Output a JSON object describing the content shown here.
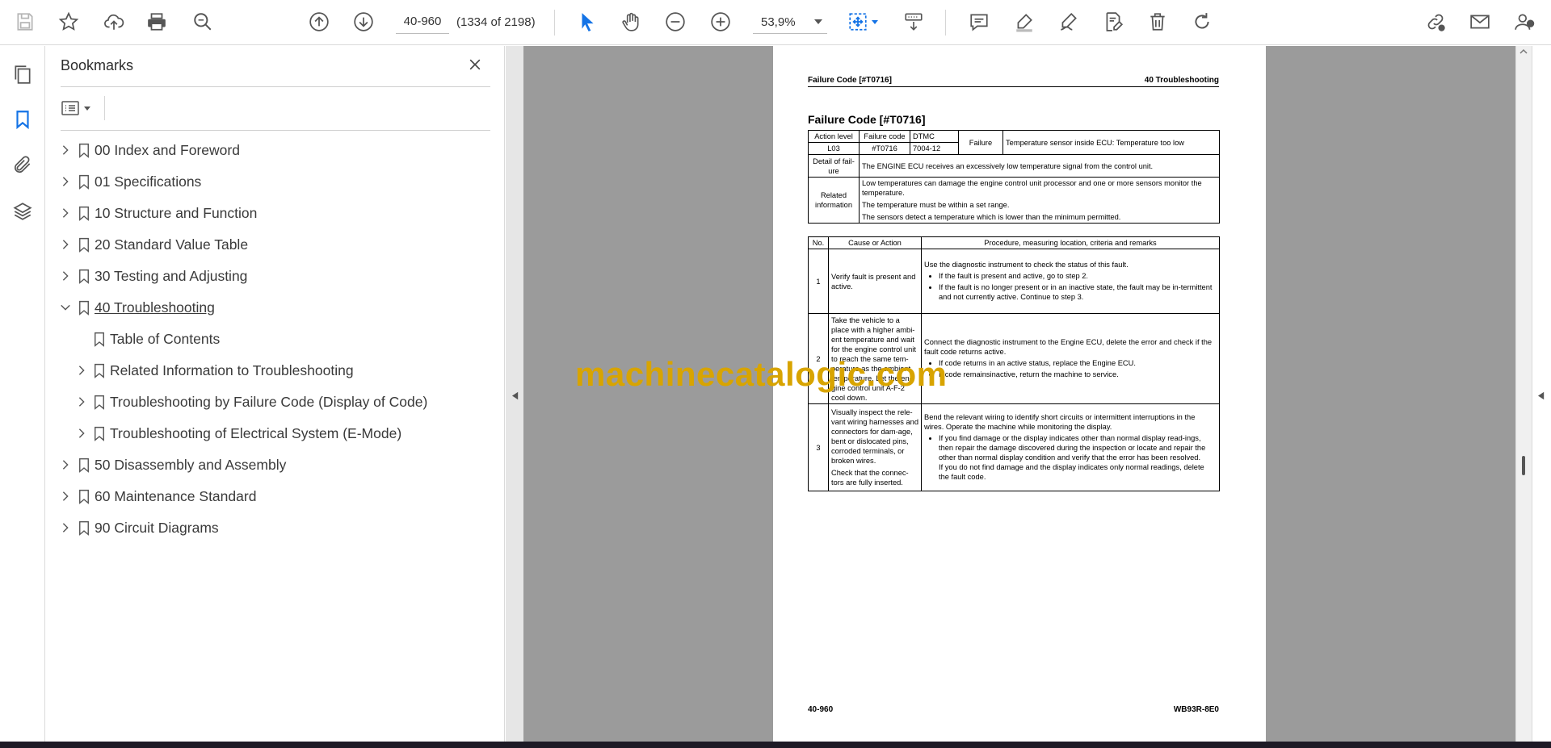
{
  "toolbar": {
    "page_value": "40-960",
    "page_count": "(1334 of 2198)",
    "zoom": "53,9%"
  },
  "bookmarks_panel": {
    "title": "Bookmarks",
    "items": [
      {
        "label": "00 Index and Foreword",
        "state": "collapsed"
      },
      {
        "label": "01 Specifications",
        "state": "collapsed"
      },
      {
        "label": "10 Structure and Function",
        "state": "collapsed"
      },
      {
        "label": "20 Standard Value Table",
        "state": "collapsed"
      },
      {
        "label": "30 Testing and Adjusting",
        "state": "collapsed"
      },
      {
        "label": "40 Troubleshooting",
        "state": "expanded"
      },
      {
        "label": "Table of Contents",
        "state": "leaf"
      },
      {
        "label": "Related Information to Troubleshooting",
        "state": "collapsed"
      },
      {
        "label": "Troubleshooting by Failure Code (Display of Code)",
        "state": "collapsed"
      },
      {
        "label": "Troubleshooting of Electrical System (E-Mode)",
        "state": "collapsed"
      },
      {
        "label": "50 Disassembly and Assembly",
        "state": "collapsed"
      },
      {
        "label": "60 Maintenance Standard",
        "state": "collapsed"
      },
      {
        "label": "90 Circuit Diagrams",
        "state": "collapsed"
      }
    ]
  },
  "document": {
    "header_left": "Failure Code [#T0716]",
    "header_right": "40 Troubleshooting",
    "title": "Failure Code [#T0716]",
    "info": {
      "action_level_label": "Action level",
      "failure_code_label": "Failure code",
      "dtmc_label": "DTMC",
      "failure_label": "Failure",
      "failure_value": "Temperature sensor inside ECU: Temperature too low",
      "action_level_value": "L03",
      "failure_code_value": "#T0716",
      "dtmc_value": "7004-12",
      "detail_label": "Detail of fail-ure",
      "detail_value": "The ENGINE ECU receives an excessively low temperature signal from the control unit.",
      "related_label": "Related information",
      "related_1": "Low temperatures can damage the engine control unit processor and one or more sensors monitor the temperature.",
      "related_2": "The temperature must be within a set range.",
      "related_3": "The sensors detect a temperature which is lower than the minimum permitted."
    },
    "steps_header": {
      "no": "No.",
      "cause": "Cause or Action",
      "procedure": "Procedure, measuring location, criteria and remarks"
    },
    "steps": {
      "s1_no": "1",
      "s1_cause": "Verify fault is present and active.",
      "s1_intro": "Use the diagnostic instrument to check the status of this fault.",
      "s1_b1": "If the fault is present and active, go to step 2.",
      "s1_b2": "If the fault is no longer present or in an inactive state, the fault may be in-termittent and not currently active. Continue to step 3.",
      "s2_no": "2",
      "s2_cause": "Take the vehicle to a place with a higher ambi-ent temperature and wait for the engine control unit to reach the same tem-perature as the ambient temperature. Let the en-gine control unit A-F-2 cool down.",
      "s2_intro": "Connect the diagnostic instrument to the Engine ECU, delete the error and check if the fault code returns active.",
      "s2_b1": "If code returns in an active status, replace the Engine ECU.",
      "s2_b2": "If code remainsinactive, return the machine to service.",
      "s3_no": "3",
      "s3_cause_1": "Visually inspect the rele-vant wiring harnesses and connectors for dam-age, bent or dislocated pins, corroded terminals, or broken wires.",
      "s3_cause_2": "Check that the connec-tors are fully inserted.",
      "s3_intro": "Bend the relevant wiring to identify short circuits or intermittent interruptions in the wires. Operate the machine while monitoring the display.",
      "s3_b1": "If you find damage or the display indicates other than normal display read-ings, then repair the damage discovered during the inspection or locate and repair the other than normal display condition and verify that the error has been resolved.",
      "s3_b1_cont": "If you do not find damage and the display indicates only normal readings, delete the fault code."
    },
    "footer_left": "40-960",
    "footer_right": "WB93R-8E0"
  },
  "watermark": "machinecatalogic.com",
  "colors": {
    "accent": "#1473e6",
    "canvas": "#9b9b9b",
    "watermark": "#d8a400"
  }
}
